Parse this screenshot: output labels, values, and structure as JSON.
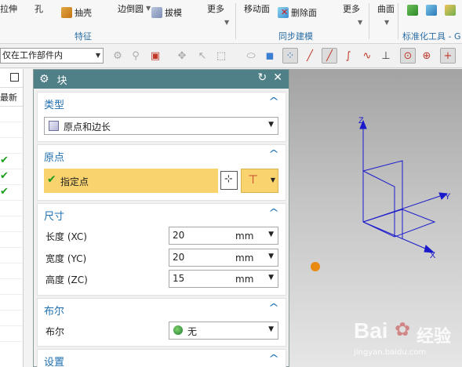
{
  "ribbon": {
    "items": [
      {
        "label": "拉伸",
        "icon": "extrude-icon"
      },
      {
        "label": "孔",
        "icon": "hole-icon"
      },
      {
        "label": "抽壳",
        "icon": "shell-icon"
      },
      {
        "label": "边倒圆",
        "icon": "edge-blend-icon"
      },
      {
        "label": "拔模",
        "icon": "draft-icon"
      },
      {
        "label": "更多",
        "icon": "more-icon"
      },
      {
        "label": "移动面",
        "icon": "move-face-icon"
      },
      {
        "label": "删除面",
        "icon": "delete-face-icon"
      },
      {
        "label": "更多",
        "icon": "more-icon"
      },
      {
        "label": "曲面",
        "icon": "surface-icon"
      }
    ],
    "groups": [
      "特征",
      "同步建模",
      "标准化工具 - G"
    ]
  },
  "toolbar": {
    "filter_value": "仅在工作部件内"
  },
  "left_nav": {
    "column_header": "最新",
    "checked_rows": 3
  },
  "dialog": {
    "title": "块",
    "sections": {
      "type": {
        "header": "类型",
        "selected": "原点和边长"
      },
      "origin": {
        "header": "原点",
        "specify_point_label": "指定点"
      },
      "dimensions": {
        "header": "尺寸",
        "fields": [
          {
            "label": "长度 (XC)",
            "value": "20",
            "unit": "mm"
          },
          {
            "label": "宽度 (YC)",
            "value": "20",
            "unit": "mm"
          },
          {
            "label": "高度 (ZC)",
            "value": "15",
            "unit": "mm"
          }
        ]
      },
      "boolean": {
        "header": "布尔",
        "label": "布尔",
        "value": "无"
      },
      "settings": {
        "header": "设置"
      }
    }
  },
  "viewport": {
    "axes": [
      "Z",
      "Y",
      "X"
    ]
  },
  "watermark": {
    "brand": "Bai",
    "brand2": "经验",
    "url": "jingyan.baidu.com"
  },
  "colors": {
    "dialog_title_bg": "#4f7f87",
    "section_header": "#1f6fb0",
    "highlight_row": "#f9d36e",
    "axis_blue": "#1a1acc",
    "point_orange": "#e88a12"
  }
}
